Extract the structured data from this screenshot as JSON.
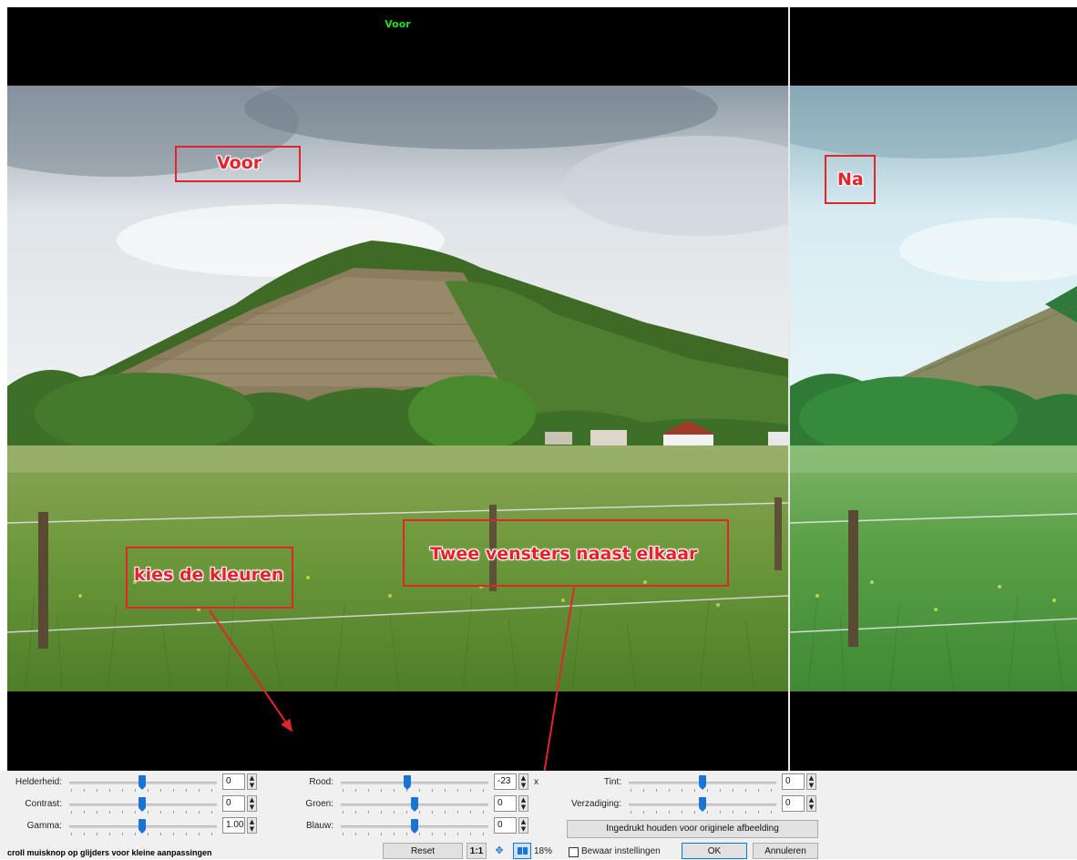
{
  "windows": {
    "before_title": "Voor"
  },
  "annotations": {
    "voor_label": "Voor",
    "na_label": "Na",
    "colors_label": "kies de kleuren",
    "side_by_side_label": "Twee vensters naast elkaar"
  },
  "sliders": {
    "brightness": {
      "label": "Helderheid:",
      "value": "0"
    },
    "contrast": {
      "label": "Contrast:",
      "value": "0"
    },
    "gamma": {
      "label": "Gamma:",
      "value": "1.00"
    },
    "red": {
      "label": "Rood:",
      "value": "-23",
      "suffix": "x"
    },
    "green": {
      "label": "Groen:",
      "value": "0"
    },
    "blue": {
      "label": "Blauw:",
      "value": "0"
    },
    "tint": {
      "label": "Tint:",
      "value": "0"
    },
    "saturation": {
      "label": "Verzadiging:",
      "value": "0"
    }
  },
  "buttons": {
    "hold_original": "Ingedrukt houden voor originele afbeelding",
    "reset": "Reset",
    "one_to_one": "1:1",
    "zoom": "18%",
    "save_settings": "Bewaar instellingen",
    "ok": "OK",
    "cancel": "Annuleren"
  },
  "status": {
    "hint": "croll muisknop op glijders voor kleine aanpassingen"
  },
  "colors": {
    "accent": "#e1262b",
    "title_green": "#1fe01f",
    "slider_thumb": "#1a74d6"
  }
}
